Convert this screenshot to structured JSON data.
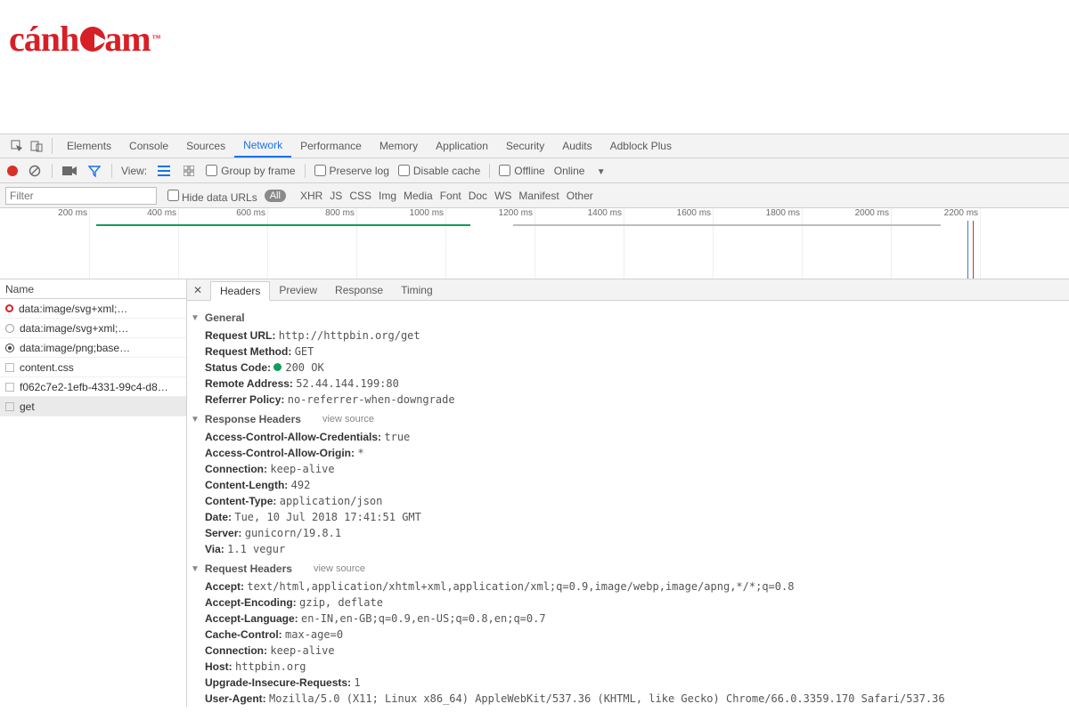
{
  "brand": {
    "text_a": "cánh",
    "text_b": "am",
    "tm": "™"
  },
  "tabs": [
    "Elements",
    "Console",
    "Sources",
    "Network",
    "Performance",
    "Memory",
    "Application",
    "Security",
    "Audits",
    "Adblock Plus"
  ],
  "tabs_selected_index": 3,
  "toolbar": {
    "view_label": "View:",
    "group_by_frame": "Group by frame",
    "preserve_log": "Preserve log",
    "disable_cache": "Disable cache",
    "offline": "Offline",
    "online": "Online"
  },
  "filterbar": {
    "filter_placeholder": "Filter",
    "hide_data_urls": "Hide data URLs",
    "all_pill": "All",
    "types": [
      "XHR",
      "JS",
      "CSS",
      "Img",
      "Media",
      "Font",
      "Doc",
      "WS",
      "Manifest",
      "Other"
    ]
  },
  "timeline": {
    "ticks_ms": [
      200,
      400,
      600,
      800,
      1000,
      1200,
      1400,
      1600,
      1800,
      2000,
      2200
    ]
  },
  "requests": {
    "header": "Name",
    "rows": [
      {
        "name": "data:image/svg+xml;…",
        "icon": "svg"
      },
      {
        "name": "data:image/svg+xml;…",
        "icon": "img"
      },
      {
        "name": "data:image/png;base…",
        "icon": "png"
      },
      {
        "name": "content.css",
        "icon": "doc"
      },
      {
        "name": "f062c7e2-1efb-4331-99c4-d8…",
        "icon": "doc"
      },
      {
        "name": "get",
        "icon": "doc",
        "selected": true
      }
    ]
  },
  "detail_tabs": [
    "Headers",
    "Preview",
    "Response",
    "Timing"
  ],
  "detail_tabs_selected_index": 0,
  "headers_panel": {
    "sections": {
      "general": {
        "title": "General",
        "items": [
          {
            "k": "Request URL:",
            "v": "http://httpbin.org/get"
          },
          {
            "k": "Request Method:",
            "v": "GET"
          },
          {
            "k": "Status Code:",
            "v": "200 OK",
            "status": true
          },
          {
            "k": "Remote Address:",
            "v": "52.44.144.199:80"
          },
          {
            "k": "Referrer Policy:",
            "v": "no-referrer-when-downgrade"
          }
        ]
      },
      "response": {
        "title": "Response Headers",
        "view_source": "view source",
        "items": [
          {
            "k": "Access-Control-Allow-Credentials:",
            "v": "true"
          },
          {
            "k": "Access-Control-Allow-Origin:",
            "v": "*"
          },
          {
            "k": "Connection:",
            "v": "keep-alive"
          },
          {
            "k": "Content-Length:",
            "v": "492"
          },
          {
            "k": "Content-Type:",
            "v": "application/json"
          },
          {
            "k": "Date:",
            "v": "Tue, 10 Jul 2018 17:41:51 GMT"
          },
          {
            "k": "Server:",
            "v": "gunicorn/19.8.1"
          },
          {
            "k": "Via:",
            "v": "1.1 vegur"
          }
        ]
      },
      "request": {
        "title": "Request Headers",
        "view_source": "view source",
        "items": [
          {
            "k": "Accept:",
            "v": "text/html,application/xhtml+xml,application/xml;q=0.9,image/webp,image/apng,*/*;q=0.8"
          },
          {
            "k": "Accept-Encoding:",
            "v": "gzip, deflate"
          },
          {
            "k": "Accept-Language:",
            "v": "en-IN,en-GB;q=0.9,en-US;q=0.8,en;q=0.7"
          },
          {
            "k": "Cache-Control:",
            "v": "max-age=0"
          },
          {
            "k": "Connection:",
            "v": "keep-alive"
          },
          {
            "k": "Host:",
            "v": "httpbin.org"
          },
          {
            "k": "Upgrade-Insecure-Requests:",
            "v": "1"
          },
          {
            "k": "User-Agent:",
            "v": "Mozilla/5.0 (X11; Linux x86_64) AppleWebKit/537.36 (KHTML, like Gecko) Chrome/66.0.3359.170 Safari/537.36"
          }
        ]
      }
    }
  }
}
